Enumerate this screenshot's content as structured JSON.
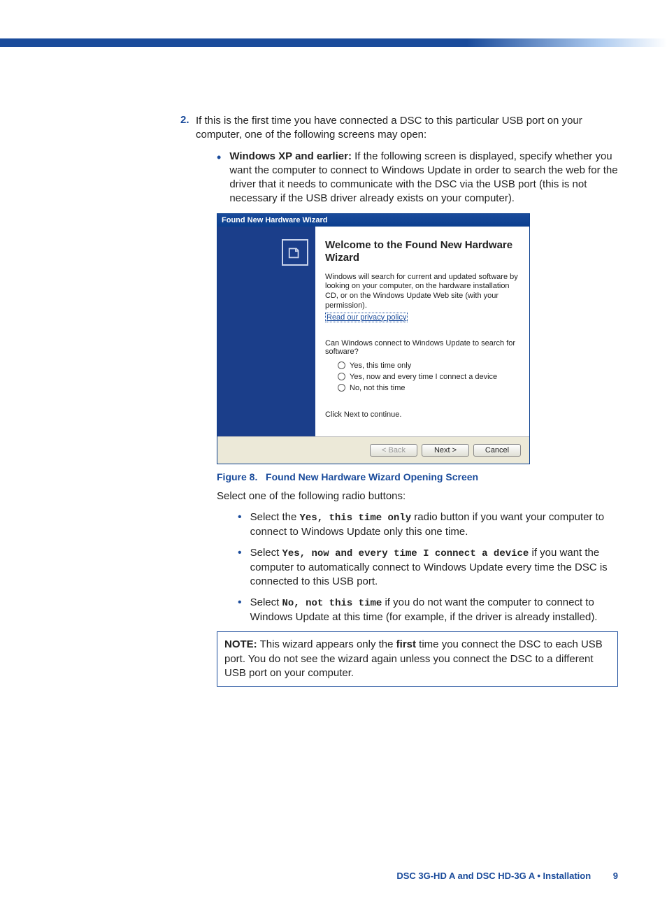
{
  "step": {
    "num": "2.",
    "intro": "If this is the first time you have connected a DSC to this particular USB port on your computer, one of the following screens may open:"
  },
  "bullet_xp": {
    "lead": "Windows XP and earlier:",
    "rest": "  If the following screen is displayed, specify whether you want the computer to connect to Windows Update in order to search the web for the driver that it needs to communicate with the DSC via the USB port (this is not necessary if the USB driver already exists on your computer)."
  },
  "wizard": {
    "title": "Found New Hardware Wizard",
    "heading": "Welcome to the Found New Hardware Wizard",
    "para": "Windows will search for current and updated software by looking on your computer, on the hardware installation CD, or on the Windows Update Web site (with your permission).",
    "link": "Read our privacy policy",
    "question": "Can Windows connect to Windows Update to search for software?",
    "radios": [
      "Yes, this time only",
      "Yes, now and every time I connect a device",
      "No, not this time"
    ],
    "continue": "Click Next to continue.",
    "buttons": {
      "back": "< Back",
      "next": "Next >",
      "cancel": "Cancel"
    }
  },
  "figcap_label": "Figure 8.",
  "figcap_text": "Found New Hardware Wizard Opening Screen",
  "select_intro": "Select one of the following radio buttons:",
  "inner": [
    {
      "pre": "Select the ",
      "code": "Yes, this time only",
      "post": " radio button if you want your computer to connect to Windows Update only this one time."
    },
    {
      "pre": "Select ",
      "code": "Yes, now and every time I connect a device",
      "post": " if you want the computer to automatically connect to Windows Update every time the DSC is connected to this USB port."
    },
    {
      "pre": "Select ",
      "code": "No, not this time",
      "post": " if you do not want the computer to connect to Windows Update at this time (for example, if the driver is already installed)."
    }
  ],
  "note": {
    "label": "NOTE:",
    "pre": "  This wizard appears only the ",
    "bold": "first",
    "post": " time you connect the DSC to each USB port. You do not see the wizard again unless you connect the DSC to a different USB port on your computer."
  },
  "footer": {
    "title": "DSC 3G-HD A and DSC HD-3G A • Installation",
    "page": "9"
  }
}
